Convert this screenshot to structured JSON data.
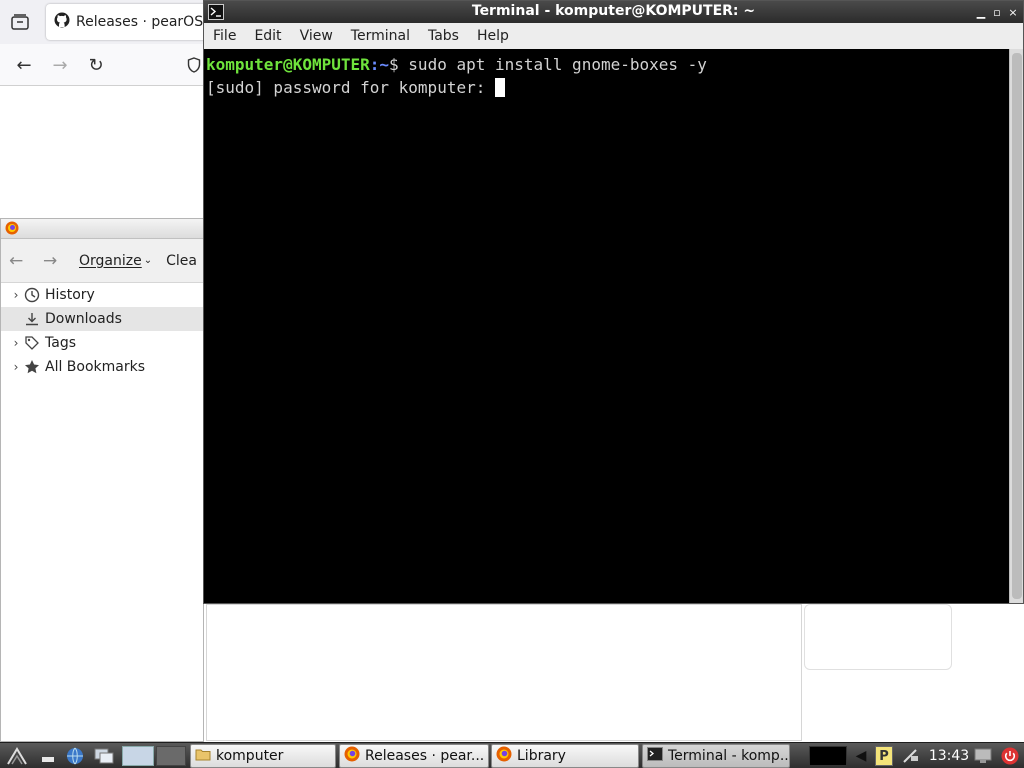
{
  "browser": {
    "tab_title": "Releases · pearOS-",
    "icons": [
      "tab-list-icon",
      "github-icon",
      "back-icon",
      "forward-icon",
      "reload-icon",
      "shield-icon"
    ]
  },
  "library": {
    "toolbar": {
      "organize_label": "Organize",
      "clear_label": "Clea"
    },
    "items": [
      {
        "label": "History",
        "icon": "clock-icon",
        "expandable": true,
        "selected": false
      },
      {
        "label": "Downloads",
        "icon": "download-icon",
        "expandable": false,
        "selected": true
      },
      {
        "label": "Tags",
        "icon": "tag-icon",
        "expandable": true,
        "selected": false
      },
      {
        "label": "All Bookmarks",
        "icon": "star-icon",
        "expandable": true,
        "selected": false
      }
    ]
  },
  "terminal": {
    "title": "Terminal - komputer@KOMPUTER: ~",
    "menu": [
      "File",
      "Edit",
      "View",
      "Terminal",
      "Tabs",
      "Help"
    ],
    "prompt_user": "komputer@KOMPUTER",
    "prompt_path": ":~",
    "prompt_symbol": "$ ",
    "command": "sudo apt install gnome-boxes -y",
    "output_line": "[sudo] password for komputer: ",
    "colors": {
      "user": "#6fe33c",
      "path": "#6b8cff",
      "background": "#000000"
    }
  },
  "taskbar": {
    "tasks": [
      {
        "label": "komputer",
        "icon": "folder-icon",
        "active": false
      },
      {
        "label": "Releases · pear...",
        "icon": "firefox-icon",
        "active": false
      },
      {
        "label": "Library",
        "icon": "firefox-icon",
        "active": false
      },
      {
        "label": "Terminal - komp...",
        "icon": "terminal-icon",
        "active": true
      }
    ],
    "clock": "13:43"
  }
}
